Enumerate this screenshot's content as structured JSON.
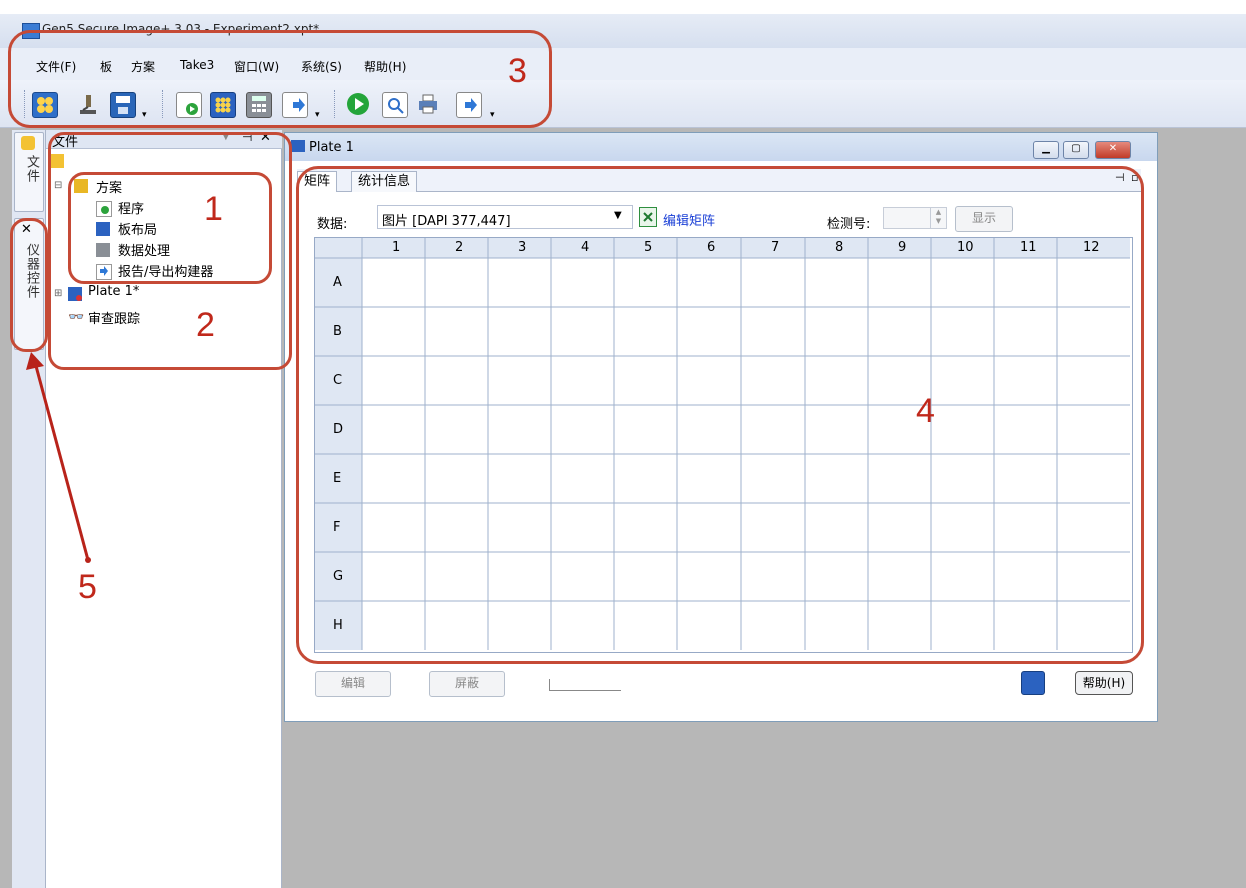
{
  "window": {
    "title": "Gen5 Secure Image+ 3.03 - Experiment2.xpt*"
  },
  "menu": [
    "文件(F)",
    "板",
    "方案",
    "Take3",
    "窗口(W)",
    "系统(S)",
    "帮助(H)"
  ],
  "side_tabs": {
    "file": "文件",
    "instrument": "仪器控件"
  },
  "tree": {
    "header": "文件",
    "protocol": "方案",
    "items": [
      "程序",
      "板布局",
      "数据处理",
      "报告/导出构建器"
    ],
    "plate": "Plate 1*",
    "audit": "审查跟踪"
  },
  "plate_window": {
    "title": "Plate 1",
    "tabs": [
      "矩阵",
      "统计信息"
    ],
    "data_label": "数据:",
    "data_value": "图片 [DAPI 377,447]",
    "edit_matrix": "编辑矩阵",
    "read_label": "检测号:",
    "show_button": "显示",
    "columns": [
      "1",
      "2",
      "3",
      "4",
      "5",
      "6",
      "7",
      "8",
      "9",
      "10",
      "11",
      "12"
    ],
    "rows": [
      "A",
      "B",
      "C",
      "D",
      "E",
      "F",
      "G",
      "H"
    ],
    "edit_button": "编辑",
    "mask_button": "屏蔽",
    "help_button": "帮助(H)"
  },
  "callouts": [
    "1",
    "2",
    "3",
    "4",
    "5"
  ],
  "colors": {
    "callout": "#c54a36",
    "accent": "#3b7cd4"
  }
}
